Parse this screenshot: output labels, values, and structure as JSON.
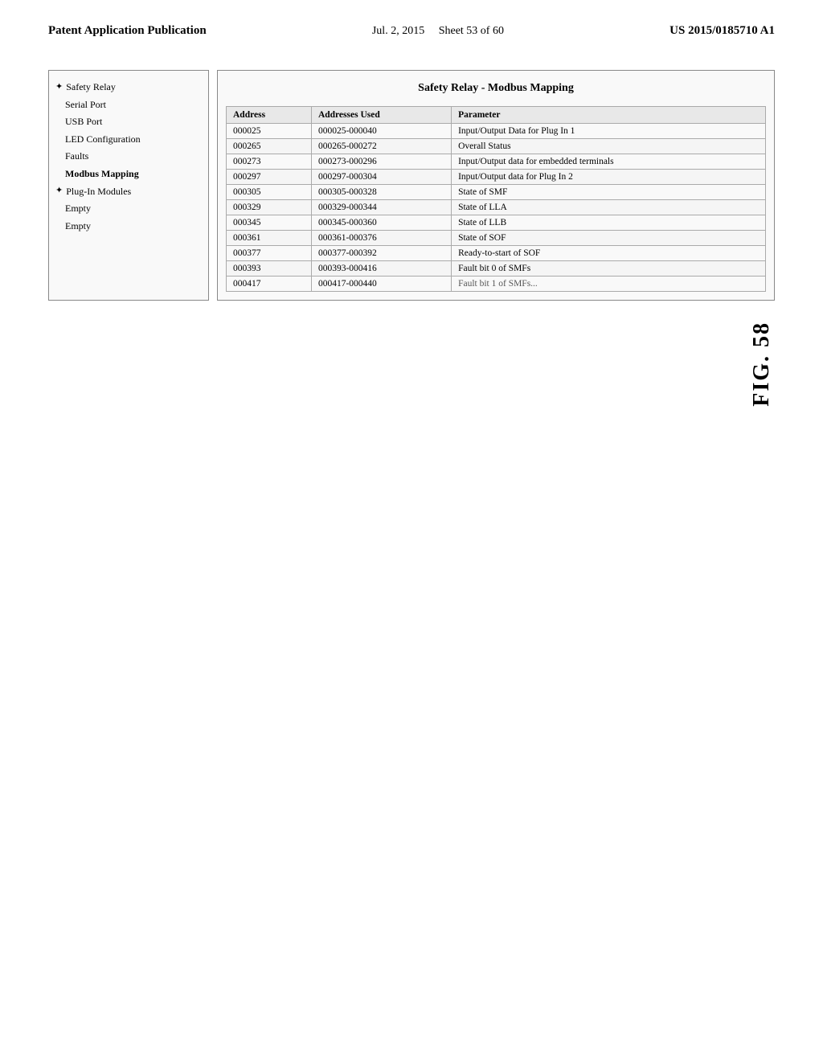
{
  "header": {
    "left": "Patent Application Publication",
    "center": "Jul. 2, 2015",
    "sheet": "Sheet 53 of 60",
    "right": "US 2015/0185710 A1"
  },
  "fig_label": "FIG. 58",
  "left_nav": {
    "title": "Safety Relay",
    "items": [
      {
        "label": "Safety Relay",
        "level": 0,
        "bullet": "✦",
        "bold": false
      },
      {
        "label": "Serial Port",
        "level": 1,
        "bullet": "",
        "bold": false
      },
      {
        "label": "USB Port",
        "level": 1,
        "bullet": "",
        "bold": false
      },
      {
        "label": "LED Configuration",
        "level": 1,
        "bullet": "",
        "bold": false
      },
      {
        "label": "Faults",
        "level": 1,
        "bullet": "",
        "bold": false
      },
      {
        "label": "Modbus Mapping",
        "level": 1,
        "bullet": "",
        "bold": true
      },
      {
        "label": "Plug-In Modules",
        "level": 0,
        "bullet": "✦",
        "bold": false
      },
      {
        "label": "Empty",
        "level": 1,
        "bullet": "",
        "bold": false
      },
      {
        "label": "Empty",
        "level": 1,
        "bullet": "",
        "bold": false
      }
    ]
  },
  "panel_title": "Safety Relay - Modbus Mapping",
  "table": {
    "headers": [
      "Address",
      "Addresses Used",
      "Parameter"
    ],
    "rows": [
      {
        "address": "000025",
        "addresses_used": "000025-000040",
        "parameter": "Input/Output Data for Plug In 1"
      },
      {
        "address": "000265",
        "addresses_used": "000265-000272",
        "parameter": "Overall Status"
      },
      {
        "address": "000273",
        "addresses_used": "000273-000296",
        "parameter": "Input/Output  data for embedded terminals"
      },
      {
        "address": "000297",
        "addresses_used": "000297-000304",
        "parameter": "Input/Output  data for Plug In 2"
      },
      {
        "address": "000305",
        "addresses_used": "000305-000328",
        "parameter": "State of SMF"
      },
      {
        "address": "000329",
        "addresses_used": "000329-000344",
        "parameter": "State of LLA"
      },
      {
        "address": "000345",
        "addresses_used": "000345-000360",
        "parameter": "State of LLB"
      },
      {
        "address": "000361",
        "addresses_used": "000361-000376",
        "parameter": "State of SOF"
      },
      {
        "address": "000377",
        "addresses_used": "000377-000392",
        "parameter": "Ready-to-start of SOF"
      },
      {
        "address": "000393",
        "addresses_used": "000393-000416",
        "parameter": "Fault bit 0 of SMFs"
      },
      {
        "address": "000417",
        "addresses_used": "000417-000440",
        "parameter": "Fault bit 1 of SMFs..."
      }
    ]
  }
}
